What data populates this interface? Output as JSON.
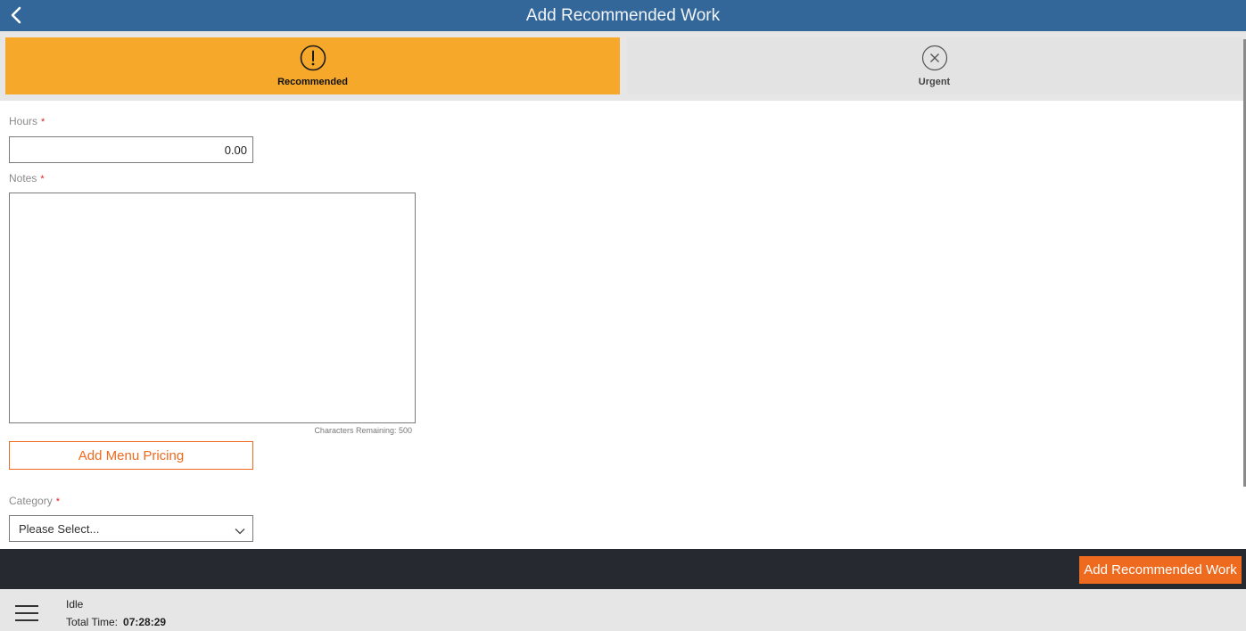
{
  "header": {
    "title": "Add Recommended Work",
    "back_icon": "chevron-left-icon"
  },
  "priority": {
    "options": [
      {
        "label": "Recommended",
        "icon": "exclamation-circle-icon",
        "selected": true
      },
      {
        "label": "Urgent",
        "icon": "x-circle-icon",
        "selected": false
      }
    ],
    "colors": {
      "selected": "#f5a82a",
      "unselected": "#e3e3e3"
    }
  },
  "form": {
    "hours": {
      "label": "Hours",
      "required_mark": "*",
      "value": "0.00"
    },
    "notes": {
      "label": "Notes",
      "required_mark": "*",
      "value": "",
      "chars_remaining": "Characters Remaining: 500"
    },
    "add_menu_pricing_label": "Add Menu Pricing",
    "category": {
      "label": "Category",
      "required_mark": "*",
      "selected": "Please Select..."
    }
  },
  "actions": {
    "add_recommended_work_label": "Add Recommended Work"
  },
  "status": {
    "state": "Idle",
    "total_time_label": "Total Time:",
    "total_time_value": "07:28:29",
    "menu_icon": "hamburger-menu-icon"
  },
  "theme": {
    "header_bg": "#336699",
    "accent": "#ee6a1e",
    "action_bar_bg": "#262a30",
    "required": "#e02020"
  }
}
